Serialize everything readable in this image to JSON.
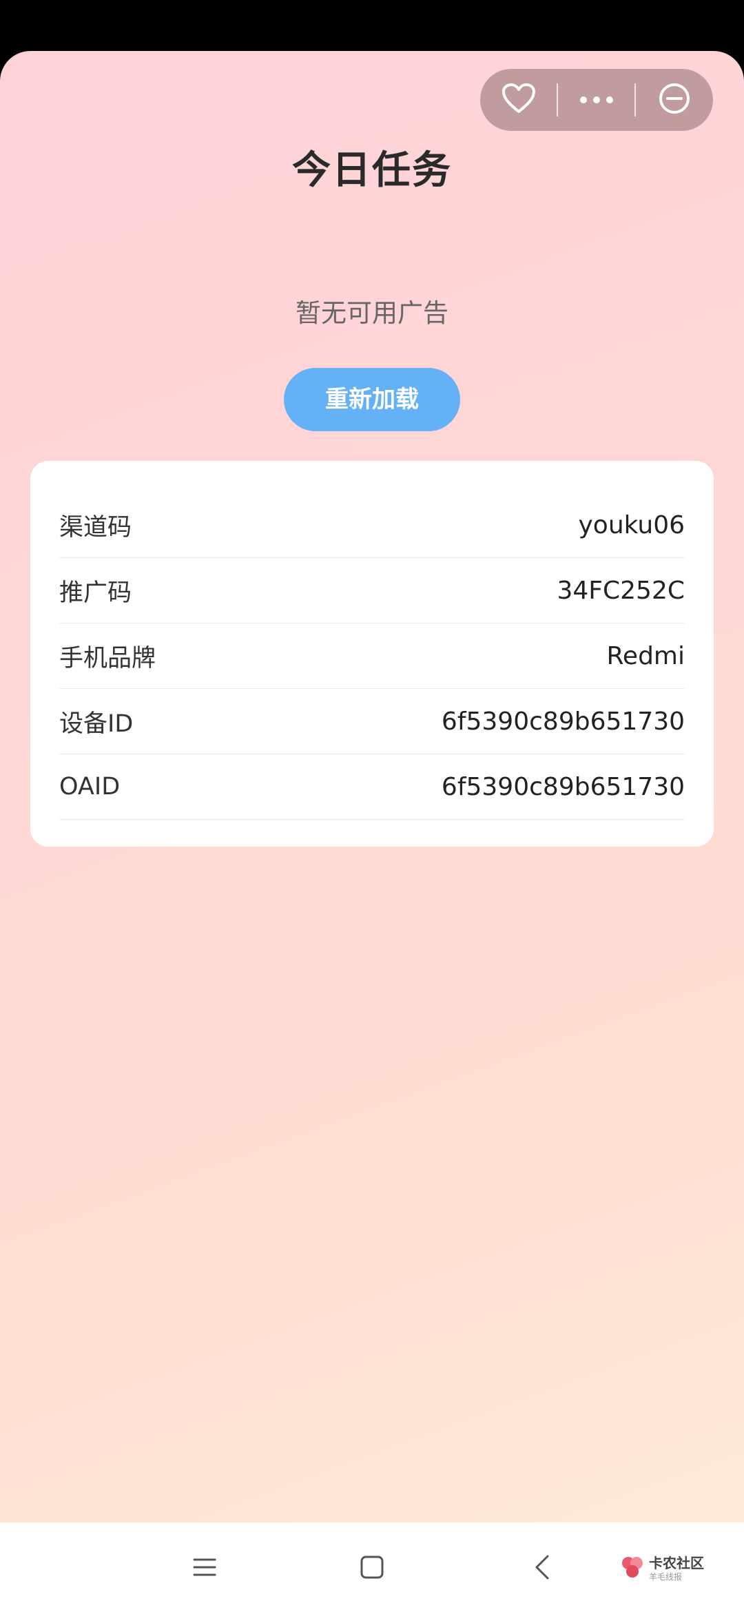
{
  "page": {
    "title": "今日任务",
    "empty_message": "暂无可用广告",
    "reload_label": "重新加载"
  },
  "capsule": {
    "icons": [
      "heart-icon",
      "more-dots-icon",
      "minimize-circle-icon"
    ]
  },
  "info": {
    "rows": [
      {
        "label": "渠道码",
        "value": "youku06"
      },
      {
        "label": "推广码",
        "value": "34FC252C"
      },
      {
        "label": "手机品牌",
        "value": "Redmi"
      },
      {
        "label": "设备ID",
        "value": "6f5390c89b651730"
      },
      {
        "label": "OAID",
        "value": "6f5390c89b651730"
      }
    ]
  },
  "navbar": {
    "icons": [
      "menu-icon",
      "home-square-icon",
      "back-chevron-icon"
    ]
  },
  "watermark": {
    "text": "卡农社区",
    "sub": "羊毛线报"
  },
  "colors": {
    "accent_button": "#64b1f5",
    "background_top": "#ffd2d8",
    "background_bottom": "#ffe9d6"
  }
}
